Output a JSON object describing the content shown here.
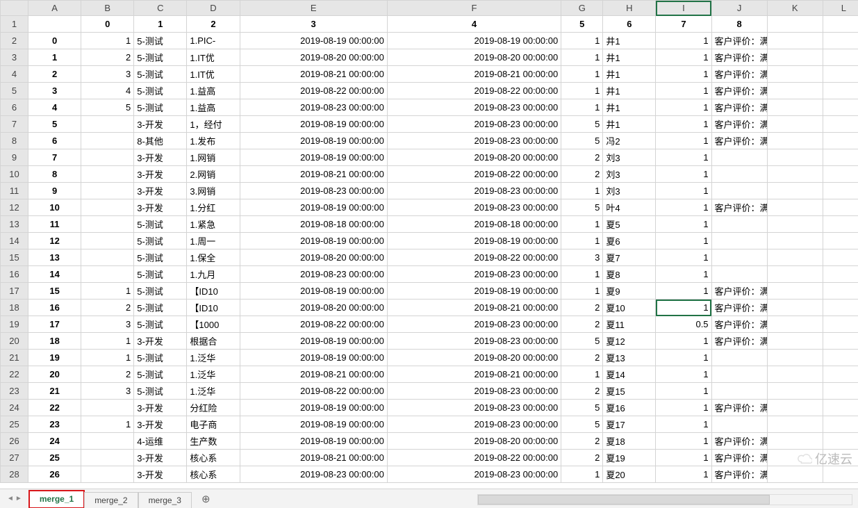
{
  "columns_letters": [
    "A",
    "B",
    "C",
    "D",
    "E",
    "F",
    "G",
    "H",
    "I",
    "J",
    "K",
    "L"
  ],
  "header_row": [
    "",
    "0",
    "1",
    "2",
    "3",
    "4",
    "5",
    "6",
    "7",
    "8",
    "",
    ""
  ],
  "active_col_index": 8,
  "selected_cell": {
    "row_ix": 17,
    "col_ix": 8
  },
  "rows": [
    {
      "A": "0",
      "B": "1",
      "C": "5-测试",
      "D": "1.PIC-",
      "E": "2019-08-19 00:00:00",
      "F": "2019-08-19 00:00:00",
      "G": "1",
      "H": "井1",
      "I": "1",
      "J": "客户评价：满意",
      "K": "",
      "L": ""
    },
    {
      "A": "1",
      "B": "2",
      "C": "5-测试",
      "D": "1.IT优",
      "E": "2019-08-20 00:00:00",
      "F": "2019-08-20 00:00:00",
      "G": "1",
      "H": "井1",
      "I": "1",
      "J": "客户评价：满意",
      "K": "",
      "L": ""
    },
    {
      "A": "2",
      "B": "3",
      "C": "5-测试",
      "D": "1.IT优",
      "E": "2019-08-21 00:00:00",
      "F": "2019-08-21 00:00:00",
      "G": "1",
      "H": "井1",
      "I": "1",
      "J": "客户评价：满意",
      "K": "",
      "L": ""
    },
    {
      "A": "3",
      "B": "4",
      "C": "5-测试",
      "D": "1.益高",
      "E": "2019-08-22 00:00:00",
      "F": "2019-08-22 00:00:00",
      "G": "1",
      "H": "井1",
      "I": "1",
      "J": "客户评价：满意",
      "K": "",
      "L": ""
    },
    {
      "A": "4",
      "B": "5",
      "C": "5-测试",
      "D": "1.益高",
      "E": "2019-08-23 00:00:00",
      "F": "2019-08-23 00:00:00",
      "G": "1",
      "H": "井1",
      "I": "1",
      "J": "客户评价：满意",
      "K": "",
      "L": ""
    },
    {
      "A": "5",
      "B": "",
      "C": "3-开发",
      "D": "1，经付",
      "E": "2019-08-19 00:00:00",
      "F": "2019-08-23 00:00:00",
      "G": "5",
      "H": "井1",
      "I": "1",
      "J": "客户评价：满意",
      "K": "",
      "L": ""
    },
    {
      "A": "6",
      "B": "",
      "C": "8-其他",
      "D": "1.发布",
      "E": "2019-08-19 00:00:00",
      "F": "2019-08-23 00:00:00",
      "G": "5",
      "H": "冯2",
      "I": "1",
      "J": "客户评价：满意",
      "K": "",
      "L": ""
    },
    {
      "A": "7",
      "B": "",
      "C": "3-开发",
      "D": "1.网销",
      "E": "2019-08-19 00:00:00",
      "F": "2019-08-20 00:00:00",
      "G": "2",
      "H": "刘3",
      "I": "1",
      "J": "",
      "K": "",
      "L": ""
    },
    {
      "A": "8",
      "B": "",
      "C": "3-开发",
      "D": "2.网销",
      "E": "2019-08-21 00:00:00",
      "F": "2019-08-22 00:00:00",
      "G": "2",
      "H": "刘3",
      "I": "1",
      "J": "",
      "K": "",
      "L": ""
    },
    {
      "A": "9",
      "B": "",
      "C": "3-开发",
      "D": "3.网销",
      "E": "2019-08-23 00:00:00",
      "F": "2019-08-23 00:00:00",
      "G": "1",
      "H": "刘3",
      "I": "1",
      "J": "",
      "K": "",
      "L": ""
    },
    {
      "A": "10",
      "B": "",
      "C": "3-开发",
      "D": "1.分红",
      "E": "2019-08-19 00:00:00",
      "F": "2019-08-23 00:00:00",
      "G": "5",
      "H": "叶4",
      "I": "1",
      "J": "客户评价：满意",
      "K": "",
      "L": ""
    },
    {
      "A": "11",
      "B": "",
      "C": "5-测试",
      "D": "1.紧急",
      "E": "2019-08-18 00:00:00",
      "F": "2019-08-18 00:00:00",
      "G": "1",
      "H": "夏5",
      "I": "1",
      "J": "",
      "K": "",
      "L": ""
    },
    {
      "A": "12",
      "B": "",
      "C": "5-测试",
      "D": "1.周一",
      "E": "2019-08-19 00:00:00",
      "F": "2019-08-19 00:00:00",
      "G": "1",
      "H": "夏6",
      "I": "1",
      "J": "",
      "K": "",
      "L": ""
    },
    {
      "A": "13",
      "B": "",
      "C": "5-测试",
      "D": "1.保全",
      "E": "2019-08-20 00:00:00",
      "F": "2019-08-22 00:00:00",
      "G": "3",
      "H": "夏7",
      "I": "1",
      "J": "",
      "K": "",
      "L": ""
    },
    {
      "A": "14",
      "B": "",
      "C": "5-测试",
      "D": "1.九月",
      "E": "2019-08-23 00:00:00",
      "F": "2019-08-23 00:00:00",
      "G": "1",
      "H": "夏8",
      "I": "1",
      "J": "",
      "K": "",
      "L": ""
    },
    {
      "A": "15",
      "B": "1",
      "C": "5-测试",
      "D": "【ID10",
      "E": "2019-08-19 00:00:00",
      "F": "2019-08-19 00:00:00",
      "G": "1",
      "H": "夏9",
      "I": "1",
      "J": "客户评价：满意",
      "K": "",
      "L": ""
    },
    {
      "A": "16",
      "B": "2",
      "C": "5-测试",
      "D": "【ID10",
      "E": "2019-08-20 00:00:00",
      "F": "2019-08-21 00:00:00",
      "G": "2",
      "H": "夏10",
      "I": "1",
      "J": "客户评价：满意",
      "K": "",
      "L": ""
    },
    {
      "A": "17",
      "B": "3",
      "C": "5-测试",
      "D": "【1000",
      "E": "2019-08-22 00:00:00",
      "F": "2019-08-23 00:00:00",
      "G": "2",
      "H": "夏11",
      "I": "0.5",
      "J": "客户评价：满意",
      "K": "",
      "L": ""
    },
    {
      "A": "18",
      "B": "1",
      "C": "3-开发",
      "D": "根据合",
      "E": "2019-08-19 00:00:00",
      "F": "2019-08-23 00:00:00",
      "G": "5",
      "H": "夏12",
      "I": "1",
      "J": "客户评价：满意",
      "K": "",
      "L": ""
    },
    {
      "A": "19",
      "B": "1",
      "C": "5-测试",
      "D": "1.泛华",
      "E": "2019-08-19 00:00:00",
      "F": "2019-08-20 00:00:00",
      "G": "2",
      "H": "夏13",
      "I": "1",
      "J": "",
      "K": "",
      "L": ""
    },
    {
      "A": "20",
      "B": "2",
      "C": "5-测试",
      "D": "1.泛华",
      "E": "2019-08-21 00:00:00",
      "F": "2019-08-21 00:00:00",
      "G": "1",
      "H": "夏14",
      "I": "1",
      "J": "",
      "K": "",
      "L": ""
    },
    {
      "A": "21",
      "B": "3",
      "C": "5-测试",
      "D": "1.泛华",
      "E": "2019-08-22 00:00:00",
      "F": "2019-08-23 00:00:00",
      "G": "2",
      "H": "夏15",
      "I": "1",
      "J": "",
      "K": "",
      "L": ""
    },
    {
      "A": "22",
      "B": "",
      "C": "3-开发",
      "D": "分红险",
      "E": "2019-08-19 00:00:00",
      "F": "2019-08-23 00:00:00",
      "G": "5",
      "H": "夏16",
      "I": "1",
      "J": "客户评价：满意",
      "K": "",
      "L": ""
    },
    {
      "A": "23",
      "B": "1",
      "C": "3-开发",
      "D": "电子商",
      "E": "2019-08-19 00:00:00",
      "F": "2019-08-23 00:00:00",
      "G": "5",
      "H": "夏17",
      "I": "1",
      "J": "",
      "K": "",
      "L": ""
    },
    {
      "A": "24",
      "B": "",
      "C": "4-运维",
      "D": "生产数",
      "E": "2019-08-19 00:00:00",
      "F": "2019-08-20 00:00:00",
      "G": "2",
      "H": "夏18",
      "I": "1",
      "J": "客户评价：满意",
      "K": "",
      "L": ""
    },
    {
      "A": "25",
      "B": "",
      "C": "3-开发",
      "D": "核心系",
      "E": "2019-08-21 00:00:00",
      "F": "2019-08-22 00:00:00",
      "G": "2",
      "H": "夏19",
      "I": "1",
      "J": "客户评价：满意",
      "K": "",
      "L": ""
    },
    {
      "A": "26",
      "B": "",
      "C": "3-开发",
      "D": "核心系",
      "E": "2019-08-23 00:00:00",
      "F": "2019-08-23 00:00:00",
      "G": "1",
      "H": "夏20",
      "I": "1",
      "J": "客户评价：满意",
      "K": "",
      "L": ""
    }
  ],
  "tabs": [
    {
      "label": "merge_1",
      "active": true
    },
    {
      "label": "merge_2",
      "active": false
    },
    {
      "label": "merge_3",
      "active": false
    }
  ],
  "tab_add_glyph": "⊕",
  "watermark": "亿速云"
}
